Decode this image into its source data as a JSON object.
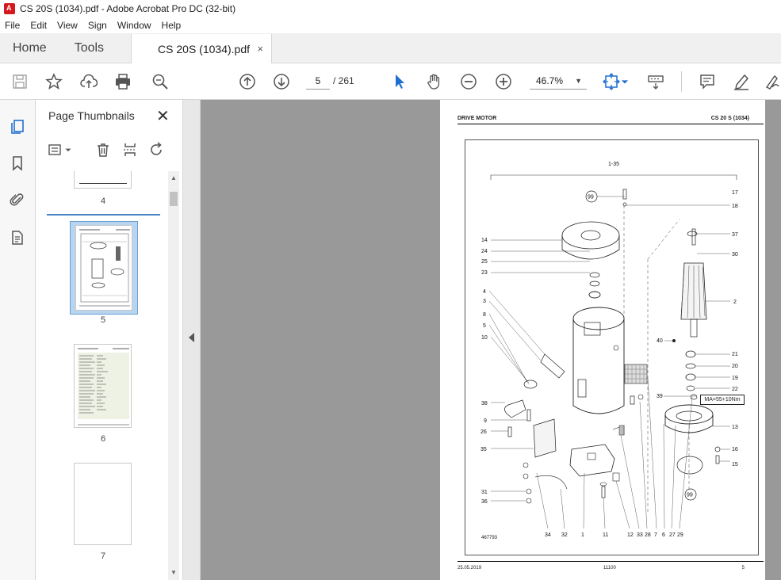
{
  "window": {
    "title": "CS 20S (1034).pdf - Adobe Acrobat Pro DC (32-bit)"
  },
  "menu": [
    "File",
    "Edit",
    "View",
    "Sign",
    "Window",
    "Help"
  ],
  "tabs": {
    "home": "Home",
    "tools": "Tools",
    "document": "CS 20S (1034).pdf",
    "close": "×"
  },
  "toolbar": {
    "page_current": "5",
    "page_total": "/ 261",
    "zoom": "46.7%"
  },
  "panel": {
    "title": "Page Thumbnails",
    "close": "✕",
    "thumbnails": [
      {
        "label": "4"
      },
      {
        "label": "5"
      },
      {
        "label": "6"
      },
      {
        "label": "7"
      }
    ]
  },
  "page": {
    "header_left": "DRIVE MOTOR",
    "header_right": "CS 20 S (1034)",
    "footer_left": "25.05.2019",
    "footer_mid": "11100",
    "footer_right": "5",
    "annotation": "MA=55+10Nm",
    "drawing_id": "467793",
    "assembly_range": "1-35",
    "callouts_left": [
      "14",
      "24",
      "25",
      "23",
      "4",
      "3",
      "8",
      "5",
      "10",
      "38",
      "9",
      "26",
      "35",
      "31",
      "36"
    ],
    "callouts_right": [
      "17",
      "18",
      "37",
      "30",
      "2",
      "21",
      "20",
      "19",
      "22",
      "39",
      "13",
      "16",
      "15",
      "40"
    ],
    "callouts_bottom": [
      "34",
      "32",
      "1",
      "11",
      "12",
      "33",
      "28",
      "7",
      "6",
      "27",
      "29"
    ],
    "circle_refs": [
      "99",
      "99"
    ]
  }
}
